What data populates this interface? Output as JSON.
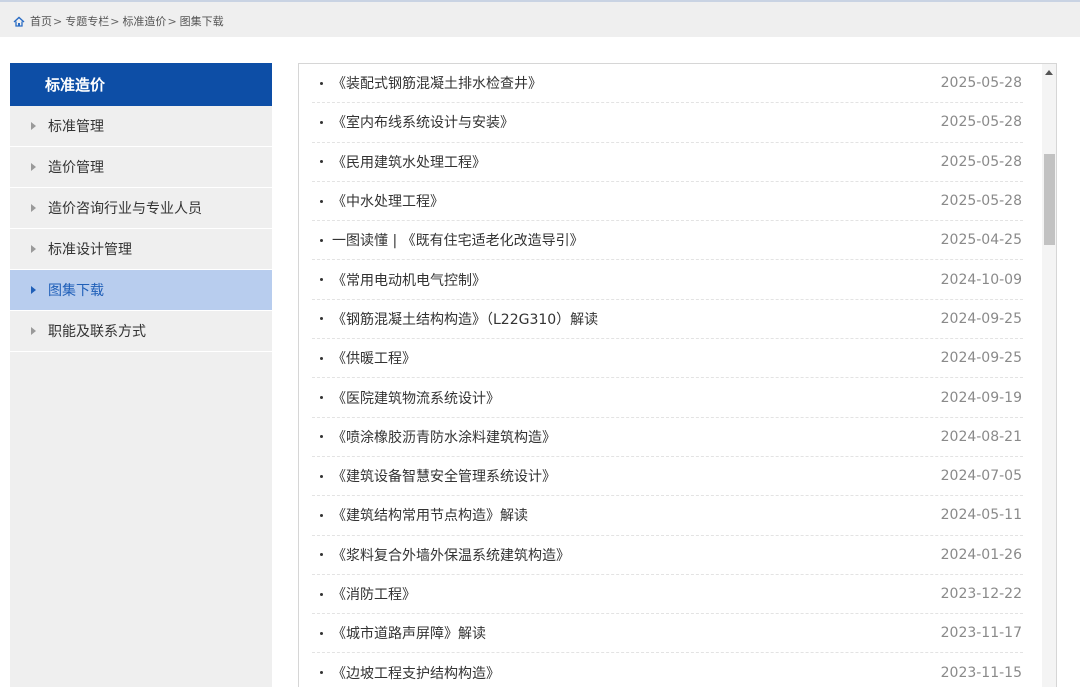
{
  "breadcrumb": {
    "home_icon": "home-icon",
    "items": [
      "首页",
      "专题专栏",
      "标准造价",
      "图集下载"
    ]
  },
  "sidebar": {
    "title": "标准造价",
    "items": [
      {
        "label": "标准管理"
      },
      {
        "label": "造价管理"
      },
      {
        "label": "造价咨询行业与专业人员"
      },
      {
        "label": "标准设计管理"
      },
      {
        "label": "图集下载",
        "active": true
      },
      {
        "label": "职能及联系方式"
      }
    ]
  },
  "list": {
    "items": [
      {
        "title": "《装配式钢筋混凝土排水检查井》",
        "date": "2025-05-28"
      },
      {
        "title": "《室内布线系统设计与安装》",
        "date": "2025-05-28"
      },
      {
        "title": "《民用建筑水处理工程》",
        "date": "2025-05-28"
      },
      {
        "title": "《中水处理工程》",
        "date": "2025-05-28"
      },
      {
        "title": "一图读懂 | 《既有住宅适老化改造导引》",
        "date": "2025-04-25"
      },
      {
        "title": "《常用电动机电气控制》",
        "date": "2024-10-09"
      },
      {
        "title": "《钢筋混凝土结构构造》（L22G310）解读",
        "date": "2024-09-25"
      },
      {
        "title": "《供暖工程》",
        "date": "2024-09-25"
      },
      {
        "title": "《医院建筑物流系统设计》",
        "date": "2024-09-19"
      },
      {
        "title": "《喷涂橡胶沥青防水涂料建筑构造》",
        "date": "2024-08-21"
      },
      {
        "title": "《建筑设备智慧安全管理系统设计》",
        "date": "2024-07-05"
      },
      {
        "title": "《建筑结构常用节点构造》解读",
        "date": "2024-05-11"
      },
      {
        "title": "《浆料复合外墙外保温系统建筑构造》",
        "date": "2024-01-26"
      },
      {
        "title": "《消防工程》",
        "date": "2023-12-22"
      },
      {
        "title": "《城市道路声屏障》解读",
        "date": "2023-11-17"
      },
      {
        "title": "《边坡工程支护结构构造》",
        "date": "2023-11-15"
      }
    ]
  },
  "colors": {
    "sidebar_header": "#0d4ea6",
    "active_item_bg": "#b8cdee",
    "active_item_text": "#1f5fb8"
  }
}
